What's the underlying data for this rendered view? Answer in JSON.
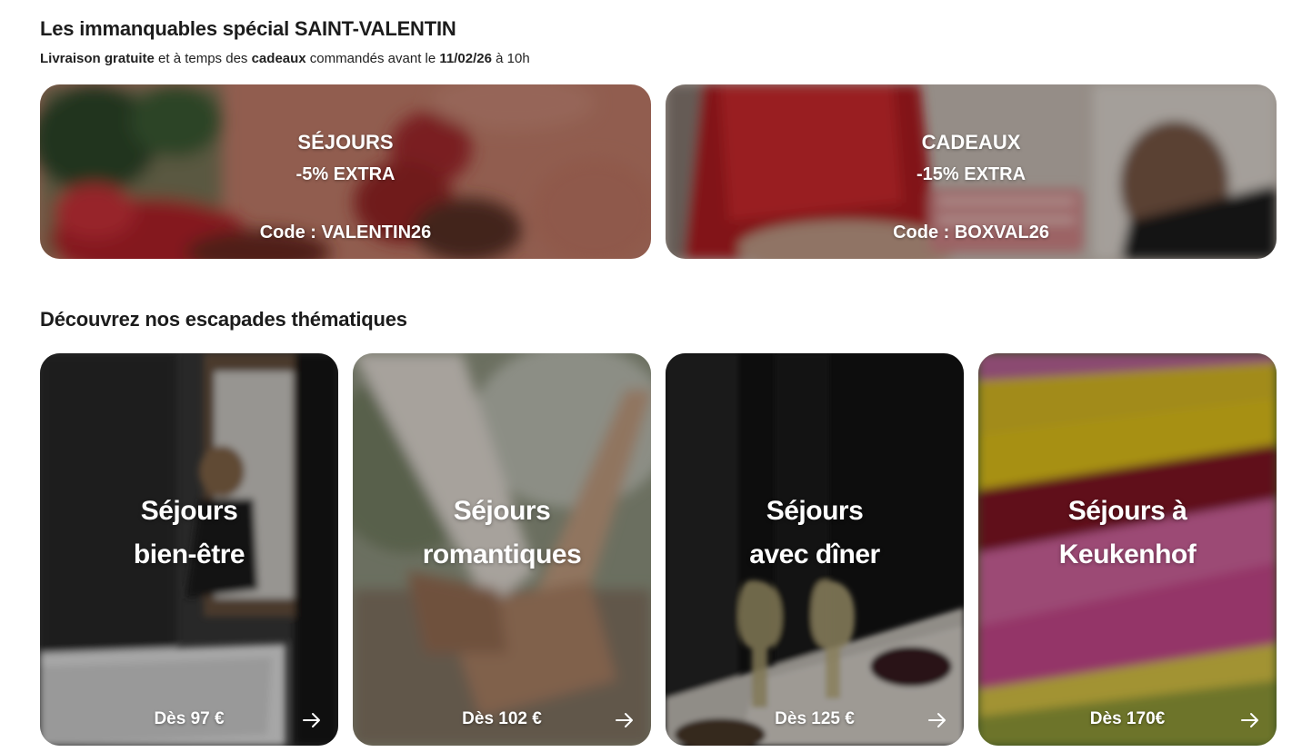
{
  "promo_section": {
    "title": "Les immanquables spécial SAINT-VALENTIN",
    "subtitle": {
      "bold1": "Livraison gratuite",
      "text1": " et à temps des ",
      "bold2": "cadeaux",
      "text2": " commandés avant le ",
      "bold3": "11/02/26",
      "text3": " à 10h"
    },
    "cards": [
      {
        "title": "SÉJOURS",
        "offer": "-5% EXTRA",
        "code": "Code : VALENTIN26"
      },
      {
        "title": "CADEAUX",
        "offer": "-15% EXTRA",
        "code": "Code : BOXVAL26"
      }
    ]
  },
  "themes_section": {
    "title": "Découvrez nos escapades thématiques",
    "cards": [
      {
        "line1": "Séjours",
        "line2": "bien-être",
        "price": "Dès 97 €",
        "icon": "arrow-right-icon"
      },
      {
        "line1": "Séjours",
        "line2": "romantiques",
        "price": "Dès 102 €",
        "icon": "arrow-right-icon"
      },
      {
        "line1": "Séjours",
        "line2": "avec dîner",
        "price": "Dès 125 €",
        "icon": "arrow-right-icon"
      },
      {
        "line1": "Séjours à",
        "line2": "Keukenhof",
        "price": "Dès 170€",
        "icon": "arrow-right-icon"
      }
    ]
  }
}
